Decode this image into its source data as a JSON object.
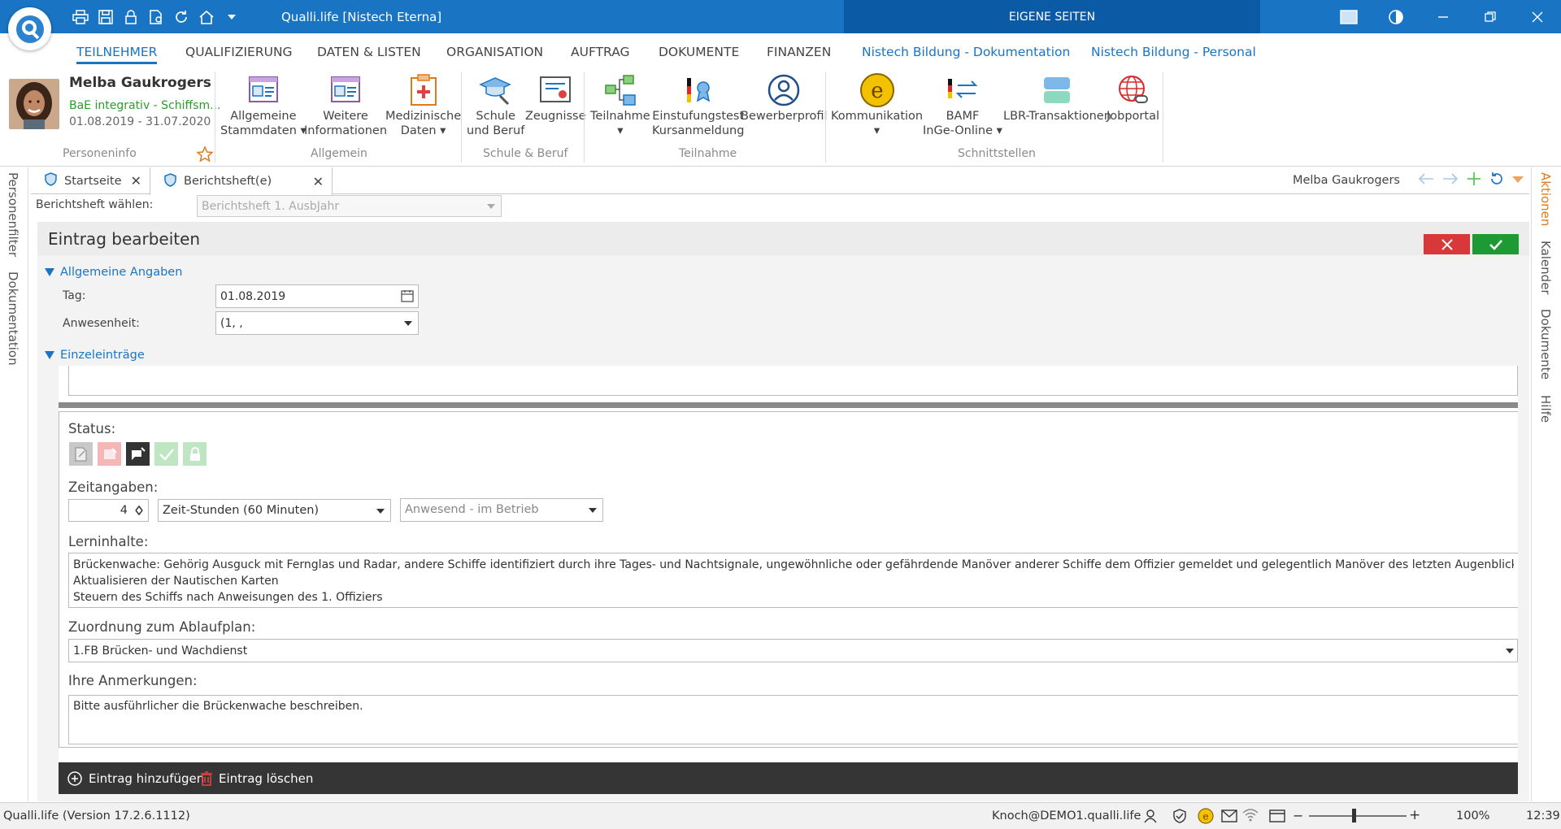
{
  "app": {
    "title": "Qualli.life [Nistech Eterna]",
    "eigene_seiten": "EIGENE SEITEN"
  },
  "menu": {
    "items": [
      "TEILNEHMER",
      "QUALIFIZIERUNG",
      "DATEN & LISTEN",
      "ORGANISATION",
      "AUFTRAG",
      "DOKUMENTE",
      "FINANZEN",
      "Nistech Bildung - Dokumentation",
      "Nistech Bildung - Personal"
    ]
  },
  "person": {
    "name": "Melba Gaukrogers",
    "course": "BaE integrativ - Schiffsm...",
    "dates": "01.08.2019 - 31.07.2020"
  },
  "ribbon": {
    "groups": [
      "Personeninfo",
      "Allgemein",
      "Schule & Beruf",
      "Teilnahme",
      "Schnittstellen"
    ],
    "buttons": {
      "stammdaten": [
        "Allgemeine",
        "Stammdaten"
      ],
      "weitere": [
        "Weitere",
        "Informationen"
      ],
      "medizin": [
        "Medizinische",
        "Daten"
      ],
      "schule": [
        "Schule",
        "und Beruf"
      ],
      "zeugnisse": "Zeugnisse",
      "teilnahme": "Teilnahme",
      "einstufung": [
        "Einstufungstest",
        "Kursanmeldung"
      ],
      "bewerber": "Bewerberprofil",
      "kommunikation": "Kommunikation",
      "bamf": [
        "BAMF",
        "InGe-Online"
      ],
      "lbr": "LBR-Transaktionen",
      "jobportal": "Jobportal"
    }
  },
  "tabs": [
    {
      "label": "Startseite"
    },
    {
      "label": "Berichtsheft(e)"
    }
  ],
  "tab_user": "Melba Gaukrogers",
  "left_panel": [
    "Personenfilter",
    "Dokumentation"
  ],
  "right_panel": [
    "Aktionen",
    "Kalender",
    "Dokumente",
    "Hilfe"
  ],
  "berichtsheft": {
    "label": "Berichtsheft wählen:",
    "value": "Berichtsheft 1. AusbJahr"
  },
  "editor": {
    "title": "Eintrag bearbeiten"
  },
  "allgemein": {
    "section": "Allgemeine Angaben",
    "tag_label": "Tag:",
    "tag_value": "01.08.2019",
    "anwesenheit_label": "Anwesenheit:",
    "anwesenheit_value": "(1, ,"
  },
  "einzel": {
    "section": "Einzeleinträge"
  },
  "entry": {
    "status_label": "Status:",
    "zeit_label": "Zeitangaben:",
    "zeit_value": "4",
    "zeit_unit": "Zeit-Stunden (60 Minuten)",
    "anwesend": "Anwesend - im Betrieb",
    "lern_label": "Lerninhalte:",
    "lern_lines": [
      "Brückenwache: Gehörig Ausguck mit Fernglas und Radar, andere Schiffe identifiziert durch ihre Tages- und Nachtsignale, ungewöhnliche oder gefährdende Manöver anderer Schiffe dem Offizier gemeldet und gelegentlich Manöver des letzten Augenblicks durchgeführt.",
      "Aktualisieren der Nautischen Karten",
      "Steuern des Schiffs nach Anweisungen des 1. Offiziers"
    ],
    "zuordnung_label": "Zuordnung zum Ablaufplan:",
    "zuordnung_value": "1.FB Brücken- und Wachdienst",
    "anmerk_label": "Ihre Anmerkungen:",
    "anmerk_value": "Bitte ausführlicher die Brückenwache beschreiben."
  },
  "bottom": {
    "add": "Eintrag hinzufügen",
    "delete": "Eintrag löschen"
  },
  "status": {
    "version": "Qualli.life (Version 17.2.6.1112)",
    "user": "Knoch@DEMO1.qualli.life",
    "zoom": "100%",
    "time": "12:39"
  },
  "colors": {
    "accent": "#1a74c4",
    "title_bar": "#1a74c4",
    "eigene": "#0a5aa6",
    "cancel": "#d9383a",
    "confirm": "#1e9a35",
    "aktionen": "#e07a1f"
  }
}
